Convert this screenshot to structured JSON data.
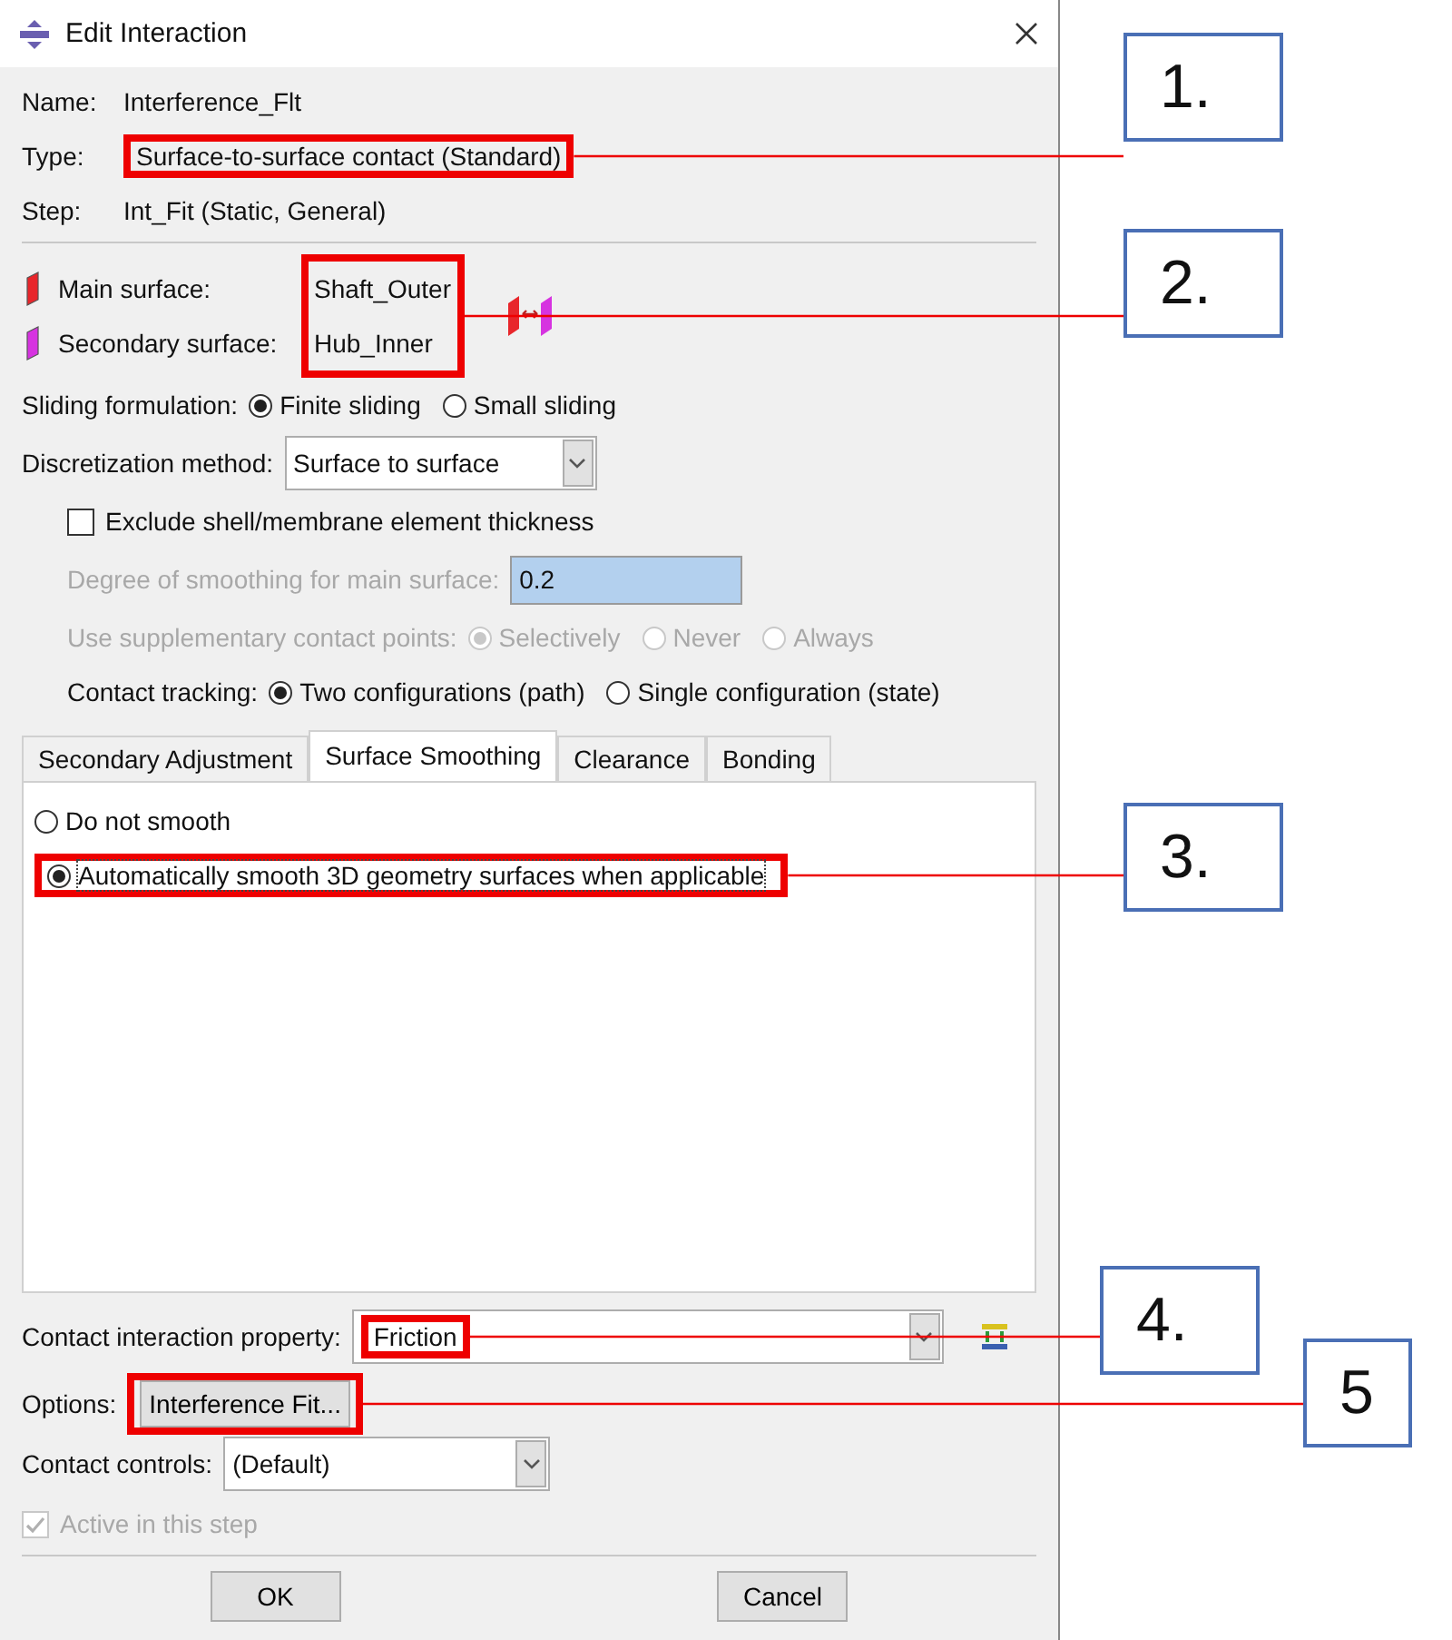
{
  "window": {
    "title": "Edit Interaction"
  },
  "info": [
    {
      "label": "Name:",
      "value": "Interference_Flt"
    },
    {
      "label": "Type:",
      "value": "Surface-to-surface contact (Standard)",
      "callout": "1."
    },
    {
      "label": "Step:",
      "value": "Int_Fit (Static, General)"
    }
  ],
  "surfaces": {
    "callout": "2.",
    "items": [
      {
        "label": "Main surface:",
        "value": "Shaft_Outer",
        "color": "#e8262b"
      },
      {
        "label": "Secondary surface:",
        "value": "Hub_Inner",
        "color": "#d633e0"
      }
    ]
  },
  "sliding": {
    "label": "Sliding formulation:",
    "options": [
      {
        "label": "Finite sliding",
        "selected": true
      },
      {
        "label": "Small sliding",
        "selected": false
      }
    ]
  },
  "discretization": {
    "label": "Discretization method:",
    "value": "Surface to surface"
  },
  "exclude_thickness": {
    "label": "Exclude shell/membrane element thickness",
    "checked": false
  },
  "smoothing_degree": {
    "label": "Degree of smoothing for main surface:",
    "value": "0.2",
    "disabled": true
  },
  "supplementary": {
    "label": "Use supplementary contact points:",
    "disabled": true,
    "options": [
      {
        "label": "Selectively",
        "selected": true
      },
      {
        "label": "Never",
        "selected": false
      },
      {
        "label": "Always",
        "selected": false
      }
    ]
  },
  "tracking": {
    "label": "Contact tracking:",
    "options": [
      {
        "label": "Two configurations (path)",
        "selected": true
      },
      {
        "label": "Single configuration (state)",
        "selected": false
      }
    ]
  },
  "tabs": [
    {
      "label": "Secondary Adjustment",
      "selected": false
    },
    {
      "label": "Surface Smoothing",
      "selected": true
    },
    {
      "label": "Clearance",
      "selected": false
    },
    {
      "label": "Bonding",
      "selected": false
    }
  ],
  "smoothing_options": [
    {
      "label": "Do not smooth",
      "selected": false,
      "focused": false
    },
    {
      "label": "Automatically smooth 3D geometry surfaces when applicable",
      "selected": true,
      "focused": true,
      "callout": "3."
    }
  ],
  "property": {
    "label": "Contact interaction property:",
    "value": "Friction",
    "callout": "4."
  },
  "options": {
    "label": "Options:",
    "button": "Interference Fit...",
    "callout": "5"
  },
  "controls": {
    "label": "Contact controls:",
    "value": "(Default)"
  },
  "active": {
    "label": "Active in this step",
    "checked": true,
    "disabled": true
  },
  "buttons": [
    "OK",
    "Cancel"
  ]
}
